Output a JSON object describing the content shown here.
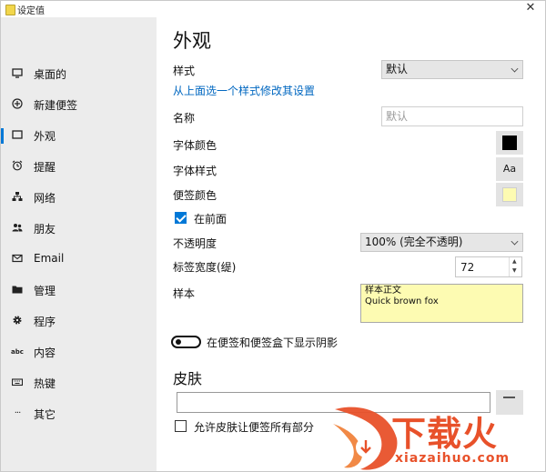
{
  "window": {
    "title": "设定值",
    "close_label": "✕"
  },
  "sidebar": {
    "items": [
      {
        "label": "桌面的",
        "icon": "monitor-icon"
      },
      {
        "label": "新建便签",
        "icon": "plus-circle-icon"
      },
      {
        "label": "外观",
        "icon": "note-icon",
        "active": true
      },
      {
        "label": "提醒",
        "icon": "alarm-clock-icon"
      },
      {
        "label": "网络",
        "icon": "network-icon"
      },
      {
        "label": "朋友",
        "icon": "people-icon"
      },
      {
        "label": "Email",
        "icon": "mail-icon"
      },
      {
        "label": "管理",
        "icon": "folder-icon"
      },
      {
        "label": "程序",
        "icon": "gear-icon"
      },
      {
        "label": "内容",
        "icon": "text-abc-icon"
      },
      {
        "label": "热键",
        "icon": "keyboard-icon"
      },
      {
        "label": "其它",
        "icon": "more-icon"
      }
    ]
  },
  "main": {
    "title": "外观",
    "style": {
      "label": "样式",
      "value": "默认",
      "link": "从上面选一个样式修改其设置"
    },
    "name": {
      "label": "名称",
      "placeholder": "默认"
    },
    "font_color": {
      "label": "字体颜色",
      "color": "#000000"
    },
    "font_style": {
      "label": "字体样式",
      "button_text": "Aa"
    },
    "note_color": {
      "label": "便签颜色",
      "color": "#fdfbb2"
    },
    "on_top": {
      "label": "在前面",
      "checked": true
    },
    "opacity": {
      "label": "不透明度",
      "value": "100% (完全不透明)"
    },
    "tab_width": {
      "label": "标签宽度(缇)",
      "value": "72"
    },
    "sample": {
      "label": "样本",
      "line1": "样本正文",
      "line2": "Quick brown fox"
    },
    "shadow_toggle": {
      "label": "在便签和便签盒下显示阴影",
      "on": false
    },
    "skin": {
      "title": "皮肤",
      "value": "",
      "allow_label": "允许皮肤让便签所有部分",
      "allow_checked": false
    }
  },
  "watermark": {
    "text": "下载火",
    "url_text": "xiazaihuo.com"
  },
  "colors": {
    "accent": "#0078d7",
    "link": "#0067c0",
    "sidebar_bg": "#ececec",
    "watermark": "#e8512a"
  }
}
